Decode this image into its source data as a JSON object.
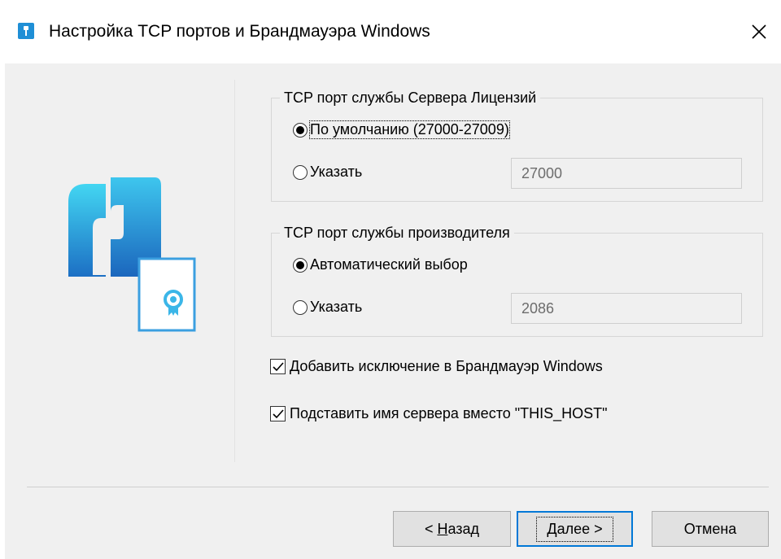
{
  "window": {
    "title": "Настройка TCP портов и Брандмауэра Windows",
    "close_glyph": "✕"
  },
  "license_port": {
    "legend": "TCP порт службы Сервера Лицензий",
    "option_default": "По умолчанию (27000-27009)",
    "option_specify": "Указать",
    "selected": "default",
    "value": "27000"
  },
  "vendor_port": {
    "legend": "TCP порт службы производителя",
    "option_auto": "Автоматический выбор",
    "option_specify": "Указать",
    "selected": "auto",
    "value": "2086"
  },
  "options": {
    "firewall_label": "Добавить исключение в Брандмауэр Windows",
    "firewall_checked": true,
    "hostname_label": "Подставить имя сервера вместо \"THIS_HOST\"",
    "hostname_checked": true
  },
  "buttons": {
    "back_prefix": "< ",
    "back_mnemonic": "Н",
    "back_rest": "азад",
    "next_mnemonic": "Д",
    "next_rest": "алее >",
    "cancel": "Отмена"
  },
  "icons": {
    "app": "installer-license-icon",
    "logo": "license-server-logo"
  },
  "colors": {
    "accent": "#0078d7",
    "logo_top": "#3fd0f0",
    "logo_bottom": "#1f78c8"
  }
}
